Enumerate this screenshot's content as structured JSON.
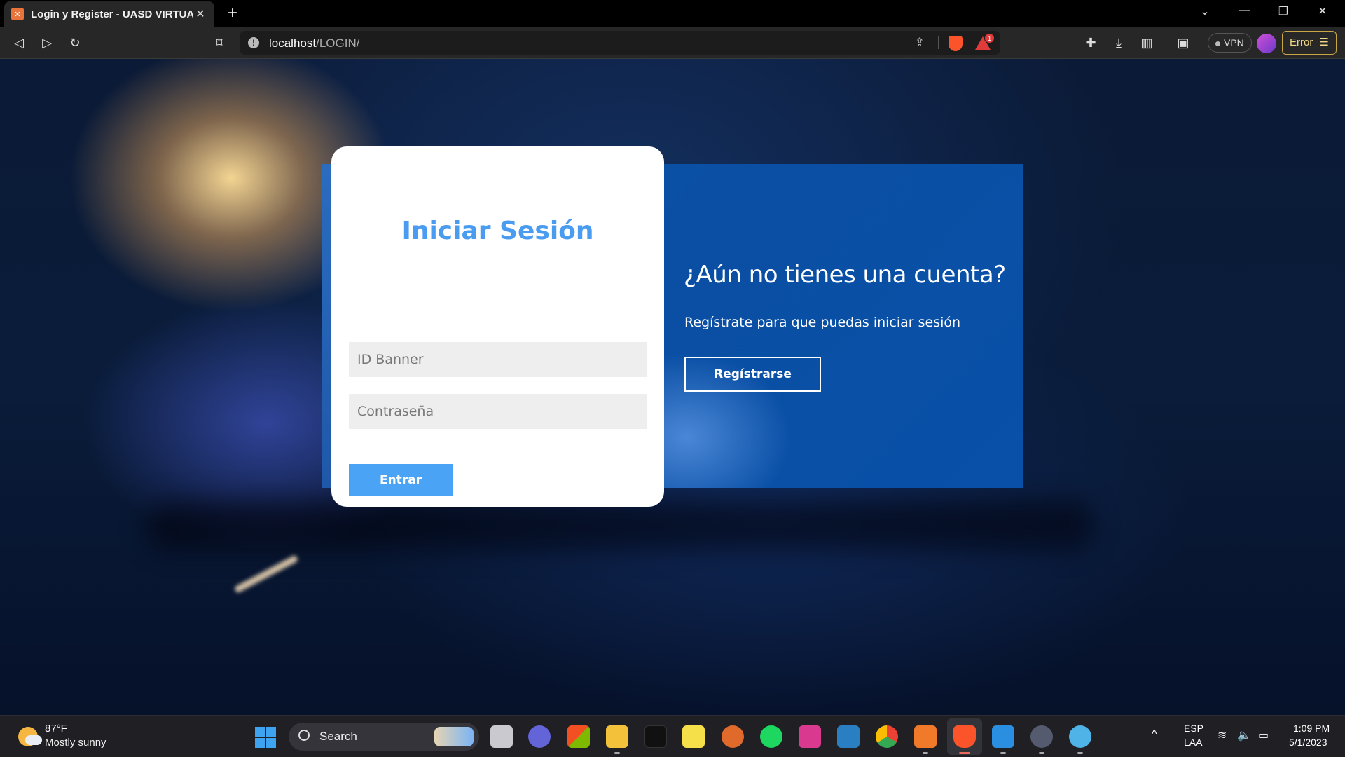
{
  "browser": {
    "tab_title": "Login y Register - UASD VIRTUAL",
    "tab_close": "✕",
    "new_tab": "+",
    "url_host": "localhost",
    "url_path": "/LOGIN/",
    "vpn_label": "VPN",
    "error_label": "Error",
    "bat_badge": "1",
    "icons": [
      "back-icon",
      "forward-icon",
      "reload-icon",
      "bookmark-icon",
      "info-icon",
      "share-icon",
      "brave-shields-icon",
      "brave-rewards-icon",
      "extensions-icon",
      "download-icon",
      "sidebar-icon",
      "wallet-icon",
      "avatar-icon",
      "menu-icon"
    ]
  },
  "login": {
    "title": "Iniciar Sesión",
    "id_placeholder": "ID Banner",
    "password_placeholder": "Contraseña",
    "submit_label": "Entrar",
    "title_color": "#4a9cf0",
    "button_color": "#4aa3f5"
  },
  "register": {
    "heading": "¿Aún no tienes una cuenta?",
    "text": "Regístrate para que puedas iniciar sesión",
    "button_label": "Regístrarse",
    "panel_color": "#0b57b0"
  },
  "taskbar": {
    "weather_temp": "87°F",
    "weather_desc": "Mostly sunny",
    "search_label": "Search",
    "language": "ESP",
    "layout": "LAA",
    "time": "1:09 PM",
    "date": "5/1/2023",
    "apps": [
      "task-view",
      "teams-chat",
      "microsoft-store",
      "file-explorer",
      "netflix",
      "live",
      "basketball",
      "spotify",
      "vm-app",
      "v-app",
      "chrome",
      "xampp",
      "brave",
      "vscode",
      "media-player",
      "paint"
    ]
  }
}
